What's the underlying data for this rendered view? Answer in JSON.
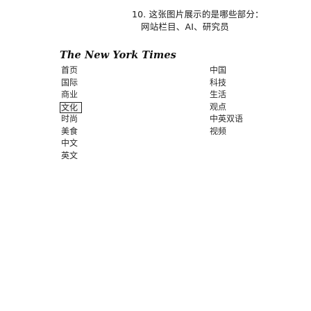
{
  "question": {
    "line1": "10. 这张图片展示的是哪些部分：",
    "line2": "网站栏目、AI、研究员"
  },
  "logo": {
    "text": "The New York Times"
  },
  "menu_left": [
    {
      "label": "首页"
    },
    {
      "label": "国际"
    },
    {
      "label": "商业"
    },
    {
      "label": "文化"
    },
    {
      "label": "时尚"
    },
    {
      "label": "美食"
    },
    {
      "label": "中文"
    },
    {
      "label": "英文"
    }
  ],
  "menu_right": [
    {
      "label": "中国"
    },
    {
      "label": "科技"
    },
    {
      "label": "生活"
    },
    {
      "label": "观点"
    },
    {
      "label": "中英双语"
    },
    {
      "label": "视频"
    }
  ],
  "selected_left_index": 3
}
